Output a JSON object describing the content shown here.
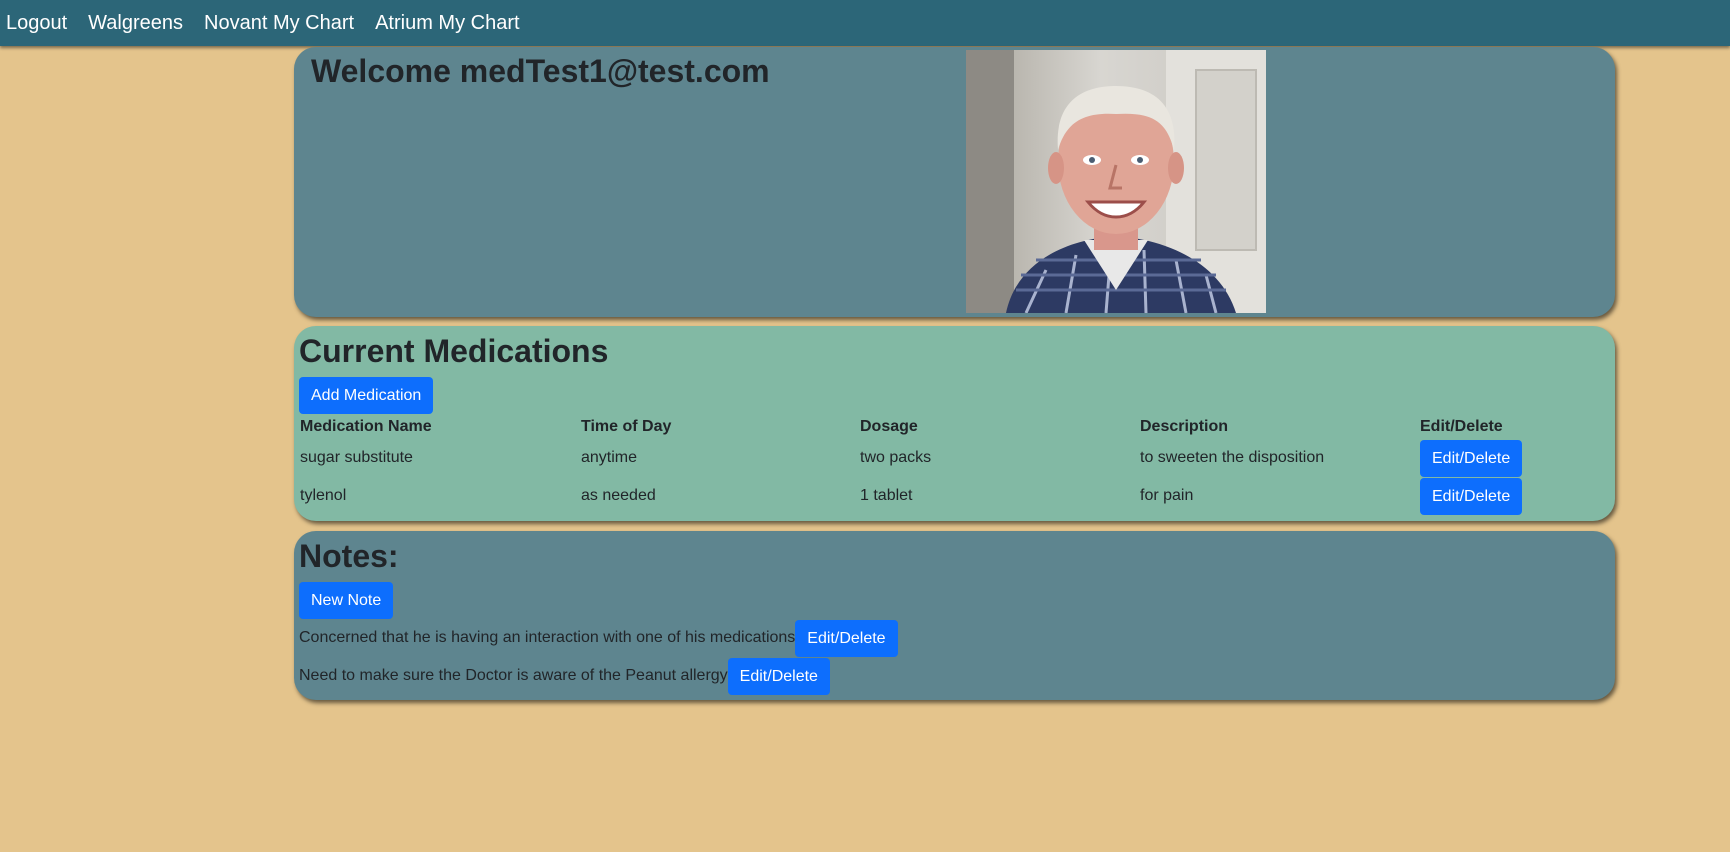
{
  "nav": {
    "links": [
      "Logout",
      "Walgreens",
      "Novant My Chart",
      "Atrium My Chart"
    ]
  },
  "welcome": {
    "title": "Welcome medTest1@test.com",
    "photo_alt": "profile photo"
  },
  "medications": {
    "title": "Current Medications",
    "add_label": "Add Medication",
    "headers": [
      "Medication Name",
      "Time of Day",
      "Dosage",
      "Description",
      "Edit/Delete"
    ],
    "rows": [
      {
        "name": "sugar substitute",
        "time": "anytime",
        "dosage": "two packs",
        "description": "to sweeten the disposition",
        "action": "Edit/Delete"
      },
      {
        "name": "tylenol",
        "time": "as needed",
        "dosage": "1 tablet",
        "description": "for pain",
        "action": "Edit/Delete"
      }
    ]
  },
  "notes": {
    "title": "Notes:",
    "new_label": "New Note",
    "items": [
      {
        "text": "Concerned that he is having an interaction with one of his medications",
        "action": "Edit/Delete"
      },
      {
        "text": "Need to make sure the Doctor is aware of the Peanut allergy",
        "action": "Edit/Delete"
      }
    ]
  },
  "colors": {
    "background": "#e4c48c",
    "nav": "#2c6678",
    "card_slate": "#5e858f",
    "card_green": "#82b9a4",
    "button": "#0d6efd"
  }
}
